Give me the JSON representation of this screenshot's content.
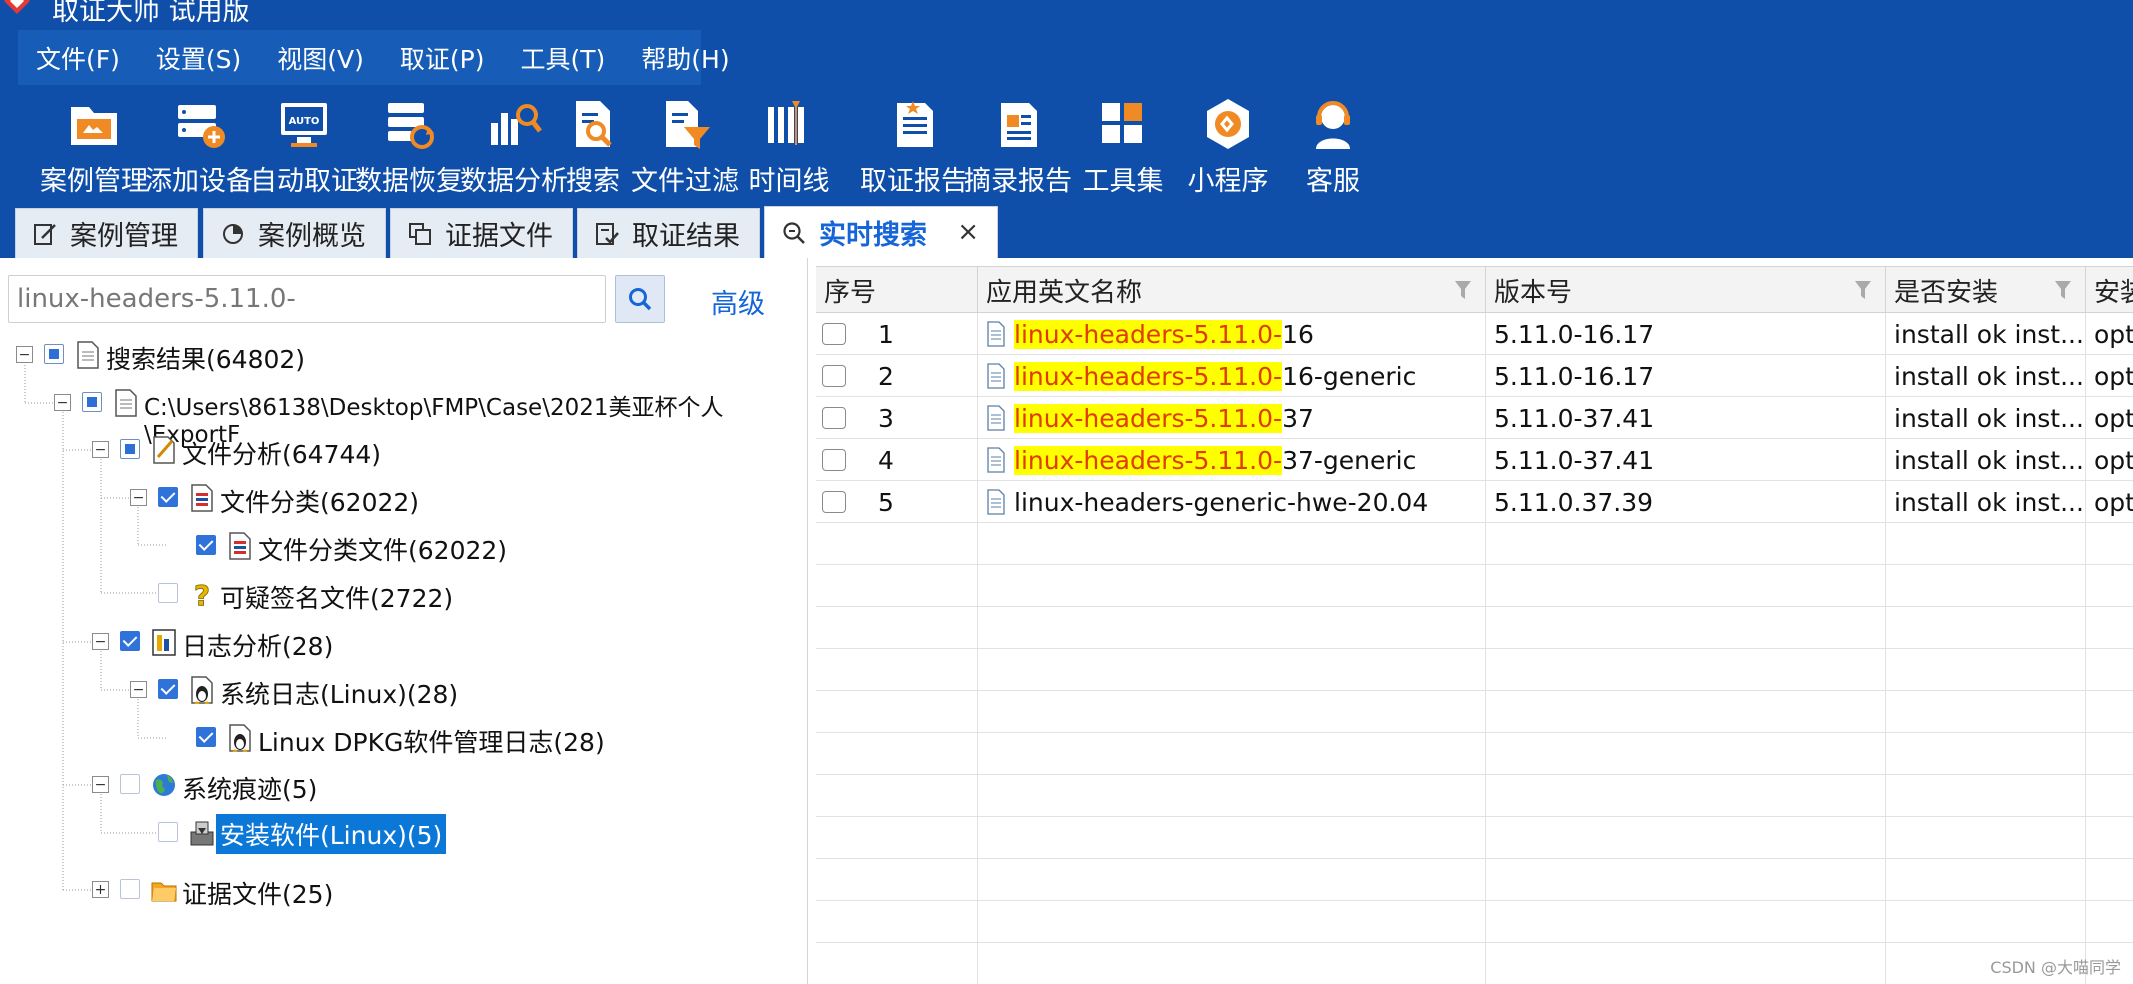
{
  "window": {
    "title": "取证大师 试用版"
  },
  "menu": {
    "items": [
      {
        "label": "文件(F)"
      },
      {
        "label": "设置(S)"
      },
      {
        "label": "视图(V)"
      },
      {
        "label": "取证(P)"
      },
      {
        "label": "工具(T)"
      },
      {
        "label": "帮助(H)"
      }
    ]
  },
  "toolbar": {
    "buttons": [
      {
        "label": "案例管理",
        "icon": "case-folder-icon"
      },
      {
        "label": "添加设备",
        "icon": "add-device-icon"
      },
      {
        "label": "自动取证",
        "icon": "auto-monitor-icon"
      },
      {
        "label": "数据恢复",
        "icon": "data-recovery-icon"
      },
      {
        "label": "数据分析",
        "icon": "data-analysis-icon"
      },
      {
        "label": "搜索",
        "icon": "search-document-icon"
      },
      {
        "label": "文件过滤",
        "icon": "file-filter-icon"
      },
      {
        "label": "时间线",
        "icon": "timeline-icon"
      },
      {
        "label": "取证报告",
        "icon": "forensic-report-icon"
      },
      {
        "label": "摘录报告",
        "icon": "excerpt-report-icon"
      },
      {
        "label": "工具集",
        "icon": "toolset-grid-icon"
      },
      {
        "label": "小程序",
        "icon": "mini-program-icon"
      },
      {
        "label": "客服",
        "icon": "customer-service-icon"
      }
    ]
  },
  "tabs": [
    {
      "label": "案例管理",
      "icon": "edit-icon"
    },
    {
      "label": "案例概览",
      "icon": "pie-chart-icon"
    },
    {
      "label": "证据文件",
      "icon": "copy-icon"
    },
    {
      "label": "取证结果",
      "icon": "checklist-icon"
    },
    {
      "label": "实时搜索",
      "icon": "search-icon",
      "active": true,
      "close": "×"
    }
  ],
  "search": {
    "value": "linux-headers-5.11.0-",
    "advanced_label": "高级"
  },
  "tree": {
    "root": "搜索结果(64802)",
    "path": "C:\\Users\\86138\\Desktop\\FMP\\Case\\2021美亚杯个人\\ExportF",
    "file_analysis": "文件分析(64744)",
    "file_category": "文件分类(62022)",
    "file_category_files": "文件分类文件(62022)",
    "suspicious_signature": "可疑签名文件(2722)",
    "log_analysis": "日志分析(28)",
    "system_log": "系统日志(Linux)(28)",
    "dpkg_log": "Linux DPKG软件管理日志(28)",
    "system_traces": "系统痕迹(5)",
    "installed_software": "安装软件(Linux)(5)",
    "evidence_files": "证据文件(25)"
  },
  "grid": {
    "columns": [
      "序号",
      "应用英文名称",
      "版本号",
      "是否安装",
      "安装"
    ],
    "rows": [
      {
        "index": "1",
        "name_hl": "linux-headers-5.11.0-",
        "name_rest": "16",
        "version": "5.11.0-16.17",
        "installed": "install ok inst...",
        "extra": "opt"
      },
      {
        "index": "2",
        "name_hl": "linux-headers-5.11.0-",
        "name_rest": "16-generic",
        "version": "5.11.0-16.17",
        "installed": "install ok inst...",
        "extra": "opt"
      },
      {
        "index": "3",
        "name_hl": "linux-headers-5.11.0-",
        "name_rest": "37",
        "version": "5.11.0-37.41",
        "installed": "install ok inst...",
        "extra": "opt"
      },
      {
        "index": "4",
        "name_hl": "linux-headers-5.11.0-",
        "name_rest": "37-generic",
        "version": "5.11.0-37.41",
        "installed": "install ok inst...",
        "extra": "opt"
      },
      {
        "index": "5",
        "name_hl": "",
        "name_rest": "linux-headers-generic-hwe-20.04",
        "version": "5.11.0.37.39",
        "installed": "install ok inst...",
        "extra": "opt"
      }
    ]
  },
  "watermark": "CSDN @大喵同学",
  "colors": {
    "titlebar": "#0f4faa",
    "accent": "#1565d8",
    "highlight_bg": "#ffff00",
    "highlight_text": "#e03b00",
    "selection": "#0b78d7"
  }
}
